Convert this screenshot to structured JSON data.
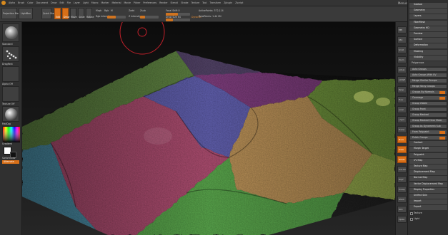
{
  "app": {
    "logo_label": "ZBrush",
    "menus": [
      "Alpha",
      "Brush",
      "Color",
      "Document",
      "Draw",
      "Edit",
      "File",
      "Layer",
      "Light",
      "Macro",
      "Marker",
      "Material",
      "Movie",
      "Picker",
      "Preferences",
      "Render",
      "Stencil",
      "Stroke",
      "Texture",
      "Tool",
      "Transform",
      "Zplugin",
      "Zscript"
    ],
    "right_info": [
      "Menus",
      "DefaultZScript"
    ]
  },
  "toolbar": {
    "projection_master": "Projection Master",
    "lightbox": "LightBox",
    "quick_sketch": "Quick Sketch",
    "edit": "Edit",
    "draw": "Draw",
    "move": "Move",
    "scale": "Scale",
    "rotate": "Rotate",
    "mrgb": "Mrgb",
    "rgb": "Rgb",
    "m": "M",
    "zadd": "Zadd",
    "zsub": "Zsub",
    "rgb_intensity": "Rgb Intensity",
    "z_intensity": "Z Intensity",
    "focal_shift": "Focal Shift 0",
    "draw_size": "Draw Size 64",
    "dynamic": "Dynamic",
    "active_points": "ActivePoints: 372,114",
    "total_points": "TotalPoints: 1.44 Mil",
    "rgb_intensity_pct": 0.45,
    "z_intensity_pct": 0.25,
    "focal_pct": 0.5,
    "draw_size_pct": 0.3
  },
  "left_shelf": {
    "brush_label": "Standard",
    "stroke_label": "DragRect",
    "alpha_label": "Alpha Off",
    "texture_label": "Texture Off",
    "material_label": "MatCap",
    "gradient_label": "Gradient",
    "switch_color": "SwitchColor",
    "alternate": "Alternate"
  },
  "right_shelf": [
    "BPR",
    "SPix",
    "Scroll",
    "Zoom",
    "Actual",
    "AAHalf",
    "Persp",
    "Floor",
    "Local",
    "L.Sym",
    "Frame",
    "Move",
    "Scale",
    "Rotate",
    "Line Fill",
    "PolyF",
    "Transp",
    "Ghost",
    "Solo",
    "Xpose"
  ],
  "tray": {
    "items": [
      {
        "label": "Subtool",
        "kind": "section"
      },
      {
        "label": "Geometry",
        "kind": "section"
      },
      {
        "label": "Layers",
        "kind": "section"
      },
      {
        "label": "FiberMesh",
        "kind": "section"
      },
      {
        "label": "Geometry HD",
        "kind": "section"
      },
      {
        "label": "Preview",
        "kind": "section"
      },
      {
        "label": "Surface",
        "kind": "section"
      },
      {
        "label": "Deformation",
        "kind": "section"
      },
      {
        "label": "Masking",
        "kind": "section"
      },
      {
        "label": "Visibility",
        "kind": "section"
      },
      {
        "label": "Polygroups",
        "kind": "sub"
      },
      {
        "label": "Auto Groups",
        "kind": "btn"
      },
      {
        "label": "Auto Groups With UV",
        "kind": "btn"
      },
      {
        "label": "Merge Similar Groups",
        "kind": "btn"
      },
      {
        "label": "Merge Stray Groups",
        "kind": "btn"
      },
      {
        "label": "Groups By Normals",
        "kind": "btn"
      },
      {
        "label": "Coverage",
        "kind": "btn"
      },
      {
        "label": "Group Visible",
        "kind": "btn"
      },
      {
        "label": "Group Front",
        "kind": "btn"
      },
      {
        "label": "Group Masked",
        "kind": "btn"
      },
      {
        "label": "Group Masked Clear Mask",
        "kind": "btn"
      },
      {
        "label": "Group As Dynamesh Sub",
        "kind": "btn"
      },
      {
        "label": "From Polypaint",
        "kind": "btn"
      },
      {
        "label": "Polish Groups",
        "kind": "btn"
      },
      {
        "label": "Contact",
        "kind": "section"
      },
      {
        "label": "Morph Target",
        "kind": "section"
      },
      {
        "label": "Polypaint",
        "kind": "section"
      },
      {
        "label": "UV Map",
        "kind": "section"
      },
      {
        "label": "Texture Map",
        "kind": "section"
      },
      {
        "label": "Displacement Map",
        "kind": "section"
      },
      {
        "label": "Normal Map",
        "kind": "section"
      },
      {
        "label": "Vector Displacement Map",
        "kind": "section"
      },
      {
        "label": "Display Properties",
        "kind": "section"
      },
      {
        "label": "Unified Skin",
        "kind": "section"
      },
      {
        "label": "Import",
        "kind": "section"
      },
      {
        "label": "Export",
        "kind": "section"
      },
      {
        "label": "Texture",
        "kind": "check"
      },
      {
        "label": "Light",
        "kind": "check"
      }
    ]
  },
  "viewport": {
    "label": "",
    "polygroup_colors": [
      "#5c7f3f",
      "#4f3f63",
      "#7a3a79",
      "#5d5ca8",
      "#6c8f3a",
      "#b58d55",
      "#a84c6d",
      "#4a8aa2",
      "#57a04a",
      "#93a84b"
    ]
  },
  "colors": {
    "accent": "#d86f18",
    "panel": "#2f2f2f",
    "bg": "#2a2a2a"
  }
}
